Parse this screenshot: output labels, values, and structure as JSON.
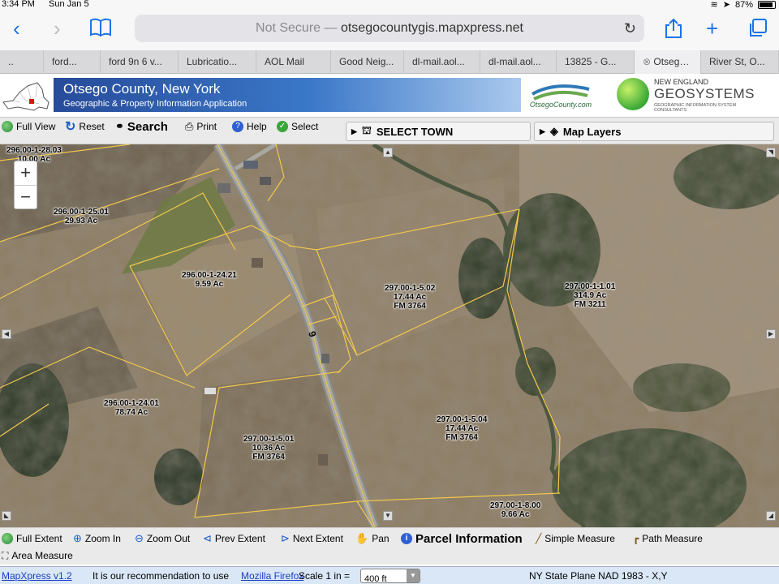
{
  "status_bar": {
    "time": "3:34 PM",
    "date": "Sun Jan 5",
    "battery": "87%"
  },
  "safari": {
    "url_prefix": "Not Secure —",
    "url_domain": "otsegocountygis.mapxpress.net",
    "tabs": [
      {
        "label": "..",
        "active": false
      },
      {
        "label": "ford...",
        "active": false
      },
      {
        "label": "ford 9n 6 v...",
        "active": false
      },
      {
        "label": "Lubricatio...",
        "active": false
      },
      {
        "label": "AOL Mail",
        "active": false
      },
      {
        "label": "Good Neig...",
        "active": false
      },
      {
        "label": "dl-mail.aol...",
        "active": false
      },
      {
        "label": "dl-mail.aol...",
        "active": false
      },
      {
        "label": "13825 - G...",
        "active": false
      },
      {
        "label": "Otsego...",
        "active": true
      },
      {
        "label": "River St, O...",
        "active": false
      }
    ]
  },
  "header": {
    "title": "Otsego County, New York",
    "subtitle": "Geographic & Property Information Application",
    "county_logo_text": "OtsegoCounty.com",
    "vendor_line1": "NEW ENGLAND",
    "vendor_line2": "GEOSYSTEMS",
    "vendor_line3": "GEOGRAPHIC INFORMATION SYSTEM CONSULTANTS"
  },
  "top_toolbar": {
    "full_view": "Full View",
    "reset": "Reset",
    "search": "Search",
    "print": "Print",
    "help": "Help",
    "select": "Select",
    "select_town": "SELECT TOWN",
    "map_layers": "Map Layers"
  },
  "map": {
    "road_label": "9",
    "parcels": [
      {
        "id": "296.00-1-28.03",
        "area": "10.00 Ac"
      },
      {
        "id": "296.00-1-25.01",
        "area": "29.93 Ac"
      },
      {
        "id": "296.00-1-24.21",
        "area": "9.59 Ac"
      },
      {
        "id": "297.00-1-5.02",
        "area": "17.44 Ac",
        "fm": "FM 3764"
      },
      {
        "id": "297.00-1-1.01",
        "area": "314.9 Ac",
        "fm": "FM 3211"
      },
      {
        "id": "296.00-1-24.01",
        "area": "78.74 Ac"
      },
      {
        "id": "297.00-1-5.04",
        "area": "17.44 Ac",
        "fm": "FM 3764"
      },
      {
        "id": "297.00-1-5.01",
        "area": "10.36 Ac",
        "fm": "FM 3764"
      },
      {
        "id": "297.00-1-8.00",
        "area": "9.66 Ac"
      }
    ]
  },
  "bottom_toolbar": {
    "full_extent": "Full Extent",
    "zoom_in": "Zoom In",
    "zoom_out": "Zoom Out",
    "prev_extent": "Prev Extent",
    "next_extent": "Next Extent",
    "pan": "Pan",
    "parcel_information": "Parcel Information",
    "simple_measure": "Simple Measure",
    "path_measure": "Path Measure",
    "area_measure": "Area Measure"
  },
  "app_status": {
    "version": "MapXpress v1.2",
    "recommendation": "It is our recommendation to use",
    "browser_link": "Mozilla Firefox",
    "scale_label": "Scale 1 in =",
    "scale_value": "400 ft",
    "projection": "NY State Plane NAD 1983 - X,Y"
  },
  "colors": {
    "parcel_line": "#f2c84b",
    "road": "#9a9a9a",
    "accent": "#1a73e8"
  }
}
